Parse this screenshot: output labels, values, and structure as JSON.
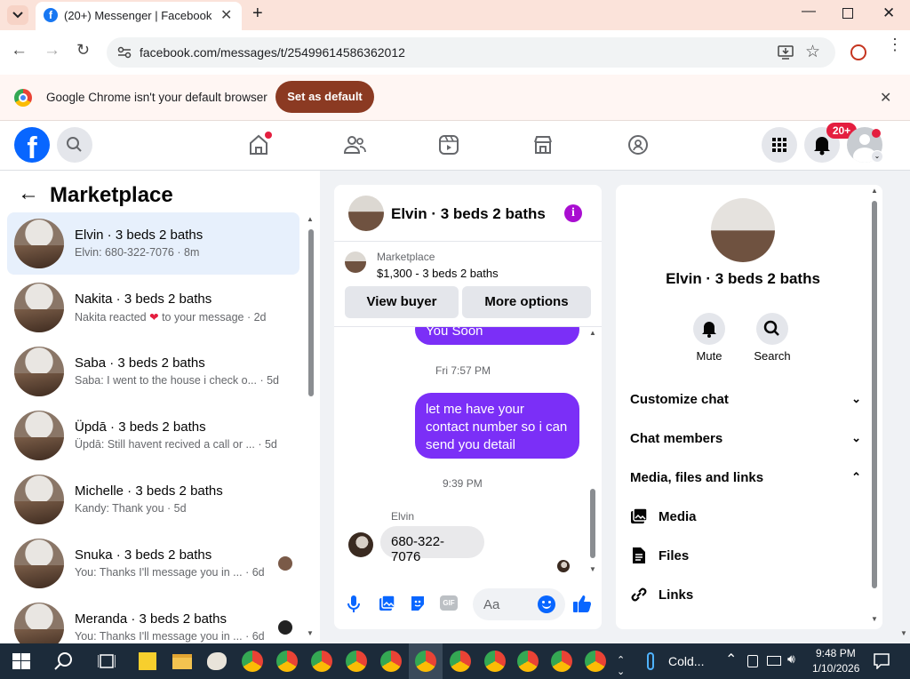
{
  "browser": {
    "tab_title": "(20+) Messenger | Facebook",
    "url": "facebook.com/messages/t/25499614586362012",
    "infobar_text": "Google Chrome isn't your default browser",
    "set_default_label": "Set as default"
  },
  "fb": {
    "logo_letter": "f",
    "notif_badge": "20+"
  },
  "sidebar": {
    "title": "Marketplace",
    "conversations": [
      {
        "name": "Elvin · 3 beds 2 baths",
        "snippet": "Elvin: 680-322-7076 · 8m"
      },
      {
        "name": "Nakita · 3 beds 2 baths",
        "snippet_before": "Nakita reacted",
        "snippet_after": "to your message · 2d"
      },
      {
        "name": "Saba · 3 beds 2 baths",
        "snippet": "Saba: I went to the house i check o... · 5d"
      },
      {
        "name": "Üpdā · 3 beds 2 baths",
        "snippet": "Üpdā: Still havent recived a call or ... · 5d"
      },
      {
        "name": "Michelle · 3 beds 2 baths",
        "snippet": "Kandy: Thank you · 5d"
      },
      {
        "name": "Snuka · 3 beds 2 baths",
        "snippet": "You: Thanks I'll message you in ... · 6d"
      },
      {
        "name": "Meranda · 3 beds 2 baths",
        "snippet": "You: Thanks I'll message you in ... · 6d"
      }
    ]
  },
  "chat": {
    "title": "Elvin · 3 beds 2 baths",
    "listing_label": "Marketplace",
    "listing_price": "$1,300 - 3 beds 2 baths",
    "view_buyer": "View buyer",
    "more_options": "More options",
    "partial_bubble": "You Soon",
    "time1": "Fri 7:57 PM",
    "bubble": "let me have your contact number so i can send you detail",
    "time2": "9:39 PM",
    "sender": "Elvin",
    "incoming": "680-322-7076",
    "input_placeholder": "Aa"
  },
  "info": {
    "name": "Elvin · 3 beds 2 baths",
    "mute": "Mute",
    "search": "Search",
    "rows": [
      "Customize chat",
      "Chat members",
      "Media, files and links"
    ],
    "media": "Media",
    "files": "Files",
    "links": "Links"
  },
  "taskbar": {
    "weather": "Cold...",
    "time": "9:48 PM",
    "date": "1/10/2026"
  }
}
